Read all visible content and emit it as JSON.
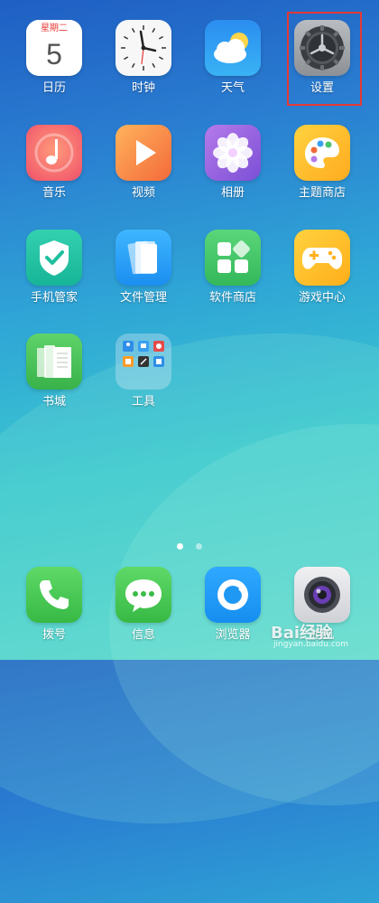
{
  "calendar": {
    "weekday": "星期二",
    "day": "5"
  },
  "apps": [
    {
      "label": "日历"
    },
    {
      "label": "时钟"
    },
    {
      "label": "天气"
    },
    {
      "label": "设置"
    },
    {
      "label": "音乐"
    },
    {
      "label": "视频"
    },
    {
      "label": "相册"
    },
    {
      "label": "主题商店"
    },
    {
      "label": "手机管家"
    },
    {
      "label": "文件管理"
    },
    {
      "label": "软件商店"
    },
    {
      "label": "游戏中心"
    },
    {
      "label": "书城"
    },
    {
      "label": "工具"
    }
  ],
  "dock": [
    {
      "label": "拨号"
    },
    {
      "label": "信息"
    },
    {
      "label": "浏览器"
    },
    {
      "label": "相机"
    }
  ],
  "page_indicator": {
    "total": 2,
    "current": 1
  },
  "watermark": {
    "brand": "Bai经验",
    "url": "jingyan.baidu.com"
  },
  "colors": {
    "highlight": "#e53935"
  }
}
